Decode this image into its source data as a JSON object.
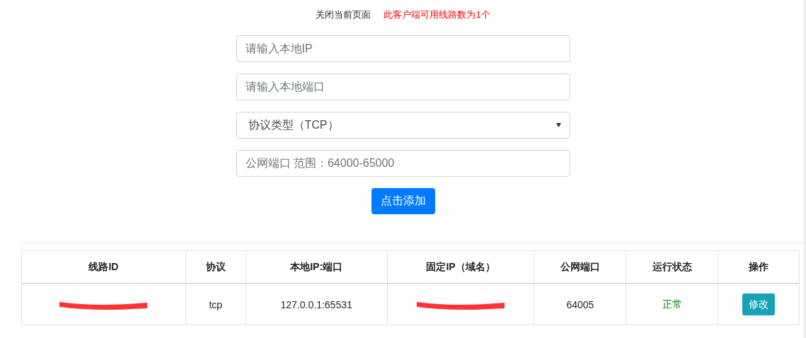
{
  "top_bar": {
    "close_link": "关闭当前页面",
    "notice": "此客户端可用线路数为1个"
  },
  "form": {
    "fields": [
      {
        "kind": "input",
        "placeholder": "请输入本地IP"
      },
      {
        "kind": "input",
        "placeholder": "请输入本地端口"
      },
      {
        "kind": "select",
        "value": "协议类型（TCP）"
      },
      {
        "kind": "input",
        "placeholder": "公网端口 范围：64000-65000"
      }
    ],
    "submit": "点击添加"
  },
  "table": {
    "columns": [
      "线路ID",
      "协议",
      "本地IP:端口",
      "固定IP（域名）",
      "公网端口",
      "运行状态",
      "操作"
    ],
    "rows": [
      {
        "cells": [
          {
            "kind": "redacted"
          },
          {
            "kind": "text",
            "text": "tcp"
          },
          {
            "kind": "text",
            "text": "127.0.0.1:65531"
          },
          {
            "kind": "redacted"
          },
          {
            "kind": "text",
            "text": "64005"
          },
          {
            "kind": "status",
            "text": "正常"
          },
          {
            "kind": "button",
            "text": "修改"
          }
        ]
      }
    ]
  }
}
